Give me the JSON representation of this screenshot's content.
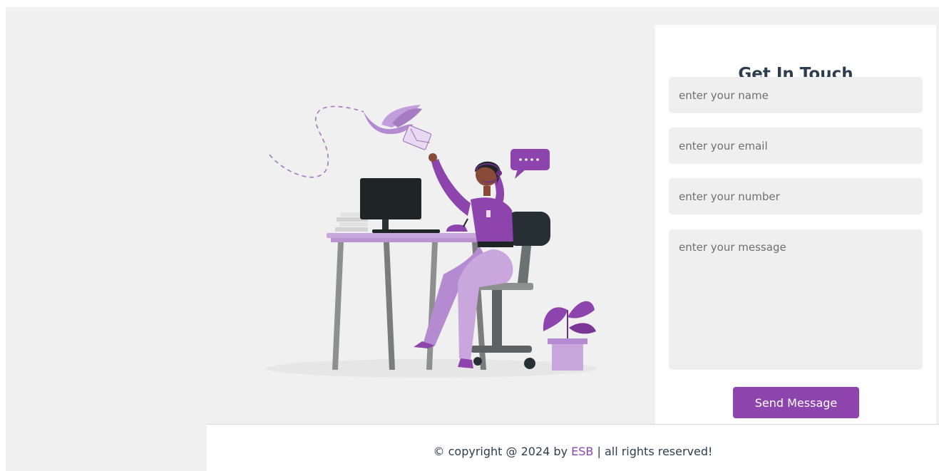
{
  "contact": {
    "title": "Get In Touch",
    "name_placeholder": "enter your name",
    "email_placeholder": "enter your email",
    "number_placeholder": "enter your number",
    "message_placeholder": "enter your message",
    "send_label": "Send Message"
  },
  "footer": {
    "prefix": "© copyright @ 2024 by ",
    "brand": "ESB",
    "suffix": " | all rights reserved!"
  },
  "illustration": {
    "icon": "customer-support-illustration",
    "chat_bubble_text": "...."
  },
  "colors": {
    "accent": "#8e44ad",
    "accent_light": "#c9a6dc",
    "background": "#f0f0f0",
    "title_text": "#2c3e50"
  }
}
